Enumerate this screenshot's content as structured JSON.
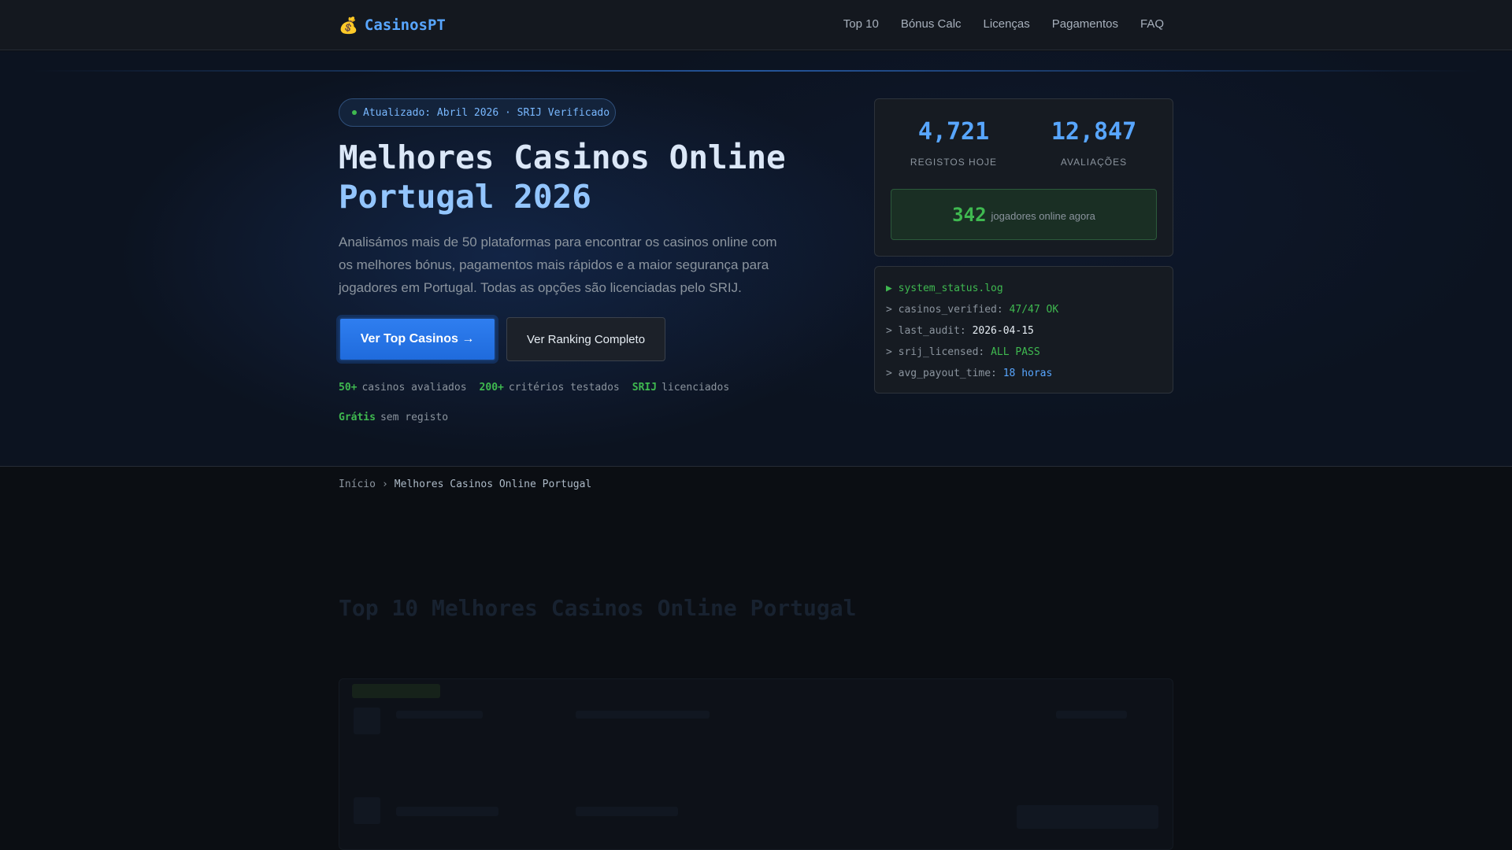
{
  "brand": {
    "name": "CasinosPT",
    "icon": "money-bag-icon"
  },
  "nav": [
    {
      "label": "Top 10"
    },
    {
      "label": "Bónus Calc"
    },
    {
      "label": "Licenças"
    },
    {
      "label": "Pagamentos"
    },
    {
      "label": "FAQ"
    }
  ],
  "hero": {
    "badge": "Atualizado: Abril 2026 · SRIJ Verificado",
    "title_line1_plain": "Melhores Casinos Online",
    "title_line2": "Portugal 2026",
    "lead": "Analisámos mais de 50 plataformas para encontrar os casinos online com os melhores bónus, pagamentos mais rápidos e a maior segurança para jogadores em Portugal. Todas as opções são licenciadas pelo SRIJ.",
    "cta_primary": "Ver Top Casinos →",
    "cta_secondary": "Ver Ranking Completo",
    "highlights": [
      {
        "value": "50+",
        "text": "casinos avaliados"
      },
      {
        "value": "200+",
        "text": "critérios testados"
      },
      {
        "value": "SRIJ",
        "text": "licenciados"
      },
      {
        "value": "Grátis",
        "text": "sem registo"
      }
    ]
  },
  "stats": {
    "registrations": {
      "value": "4,721",
      "label": "Registos hoje"
    },
    "reviews": {
      "value": "12,847",
      "label": "Avaliações"
    },
    "online": {
      "value": "342",
      "label": "jogadores online agora"
    }
  },
  "log": {
    "title": "system_status.log",
    "lines": [
      {
        "key": "casinos_verified:",
        "value": "47/47 OK"
      },
      {
        "key": "last_audit:",
        "value": "2026-04-15"
      },
      {
        "key": "srij_licensed:",
        "value": "ALL PASS"
      },
      {
        "key": "avg_payout_time:",
        "value": "18 horas"
      }
    ]
  },
  "breadcrumb": {
    "home": "Início",
    "sep": "›",
    "current": "Melhores Casinos Online Portugal"
  },
  "section": {
    "title": "Top 10 Melhores Casinos Online Portugal"
  },
  "colors": {
    "accent": "#58a6ff",
    "success": "#3fb950",
    "background": "#0b0e13",
    "primary_button": "#1f6bdc"
  }
}
